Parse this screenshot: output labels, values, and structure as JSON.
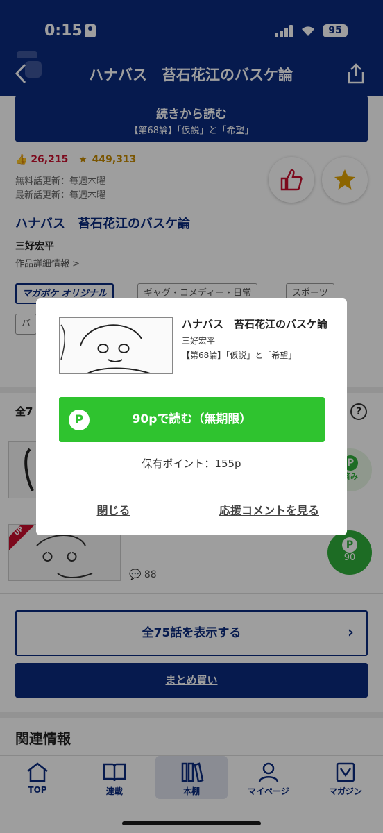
{
  "status_bar": {
    "time": "0:15",
    "battery": "95"
  },
  "nav": {
    "title": "ハナバス　苔石花江のバスケ論"
  },
  "continue_button": {
    "label": "続きから読む",
    "episode": "【第68論】「仮説」と「希望」"
  },
  "stats": {
    "likes": "26,215",
    "favorites": "449,313"
  },
  "update_info": {
    "free": "無料話更新：毎週木曜",
    "latest": "最新話更新：毎週木曜"
  },
  "work": {
    "title": "ハナバス　苔石花江のバスケ論",
    "author": "三好宏平",
    "detail_link": "作品詳細情報 >"
  },
  "tags": [
    "マガポケ オリジナル",
    "ギャグ・コメディー・日常",
    "スポーツ",
    "バ"
  ],
  "episodes": {
    "header": "全7",
    "read_label": "済み",
    "points_cost": "90",
    "comment_count": "88",
    "up_badge": "UP"
  },
  "all_episodes_button": {
    "label": "全75話を表示する"
  },
  "bulk_buy_button": {
    "label": "まとめ買い"
  },
  "related_heading": "関連情報",
  "tabbar": [
    {
      "label": "TOP",
      "icon": "home-icon"
    },
    {
      "label": "連載",
      "icon": "book-icon"
    },
    {
      "label": "本棚",
      "icon": "bookshelf-icon"
    },
    {
      "label": "マイページ",
      "icon": "person-icon"
    },
    {
      "label": "マガジン",
      "icon": "magazine-icon"
    }
  ],
  "modal": {
    "title": "ハナバス　苔石花江のバスケ論",
    "author": "三好宏平",
    "episode": "【第68論】「仮説」と「希望」",
    "read_button": "90pで読む（無期限）",
    "points_held": "保有ポイント：155p",
    "close": "閉じる",
    "view_comments": "応援コメントを見る"
  },
  "colors": {
    "brand_navy": "#0b2a7e",
    "read_green": "#2fc32f",
    "points_green": "#2fae3a",
    "like_red": "#c8102e",
    "star_gold": "#e2a400"
  }
}
